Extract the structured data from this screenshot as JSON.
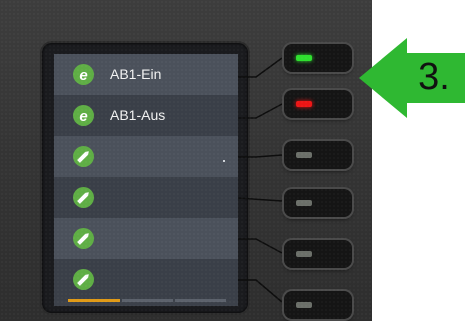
{
  "lines": [
    {
      "icon": "e-globe-icon",
      "label": "AB1-Ein",
      "led": "green"
    },
    {
      "icon": "e-globe-icon",
      "label": "AB1-Aus",
      "led": "red"
    },
    {
      "icon": "pencil-icon",
      "label": "",
      "led": "off"
    },
    {
      "icon": "pencil-icon",
      "label": "",
      "led": "off"
    },
    {
      "icon": "pencil-icon",
      "label": "",
      "led": "off"
    },
    {
      "icon": "pencil-icon",
      "label": "",
      "led": "off"
    }
  ],
  "callout": {
    "text": "3."
  },
  "page_indicator": {
    "active_page": 1,
    "pages": 3
  },
  "colors": {
    "badge": "#5fae45",
    "led_green": "#2fe02f",
    "led_red": "#ee1515",
    "led_off": "#6b6f69",
    "arrow": "#2fb832",
    "progress_active": "#e09a17"
  }
}
